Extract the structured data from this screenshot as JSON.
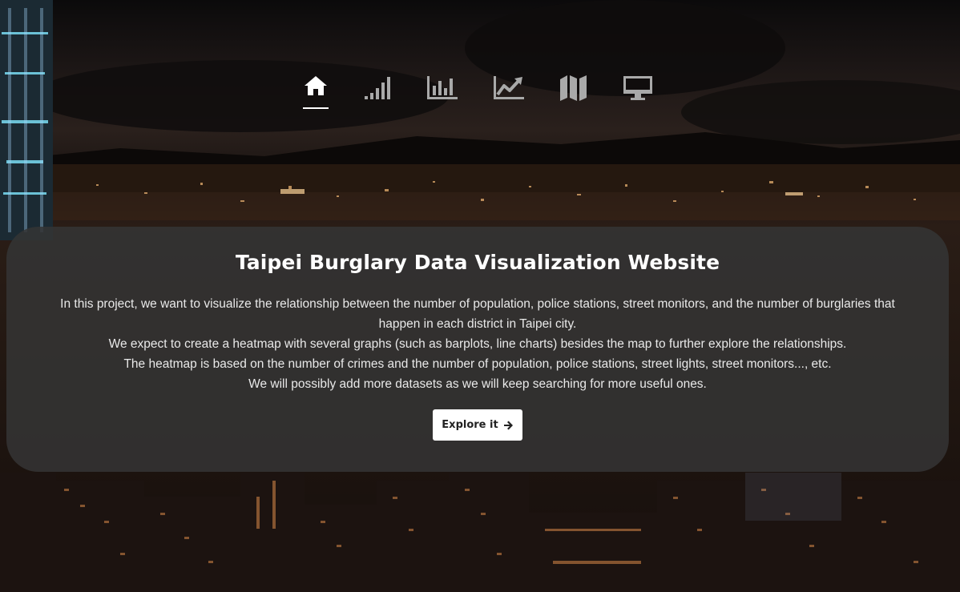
{
  "colors": {
    "nav_active": "#ffffff",
    "nav_inactive": "#a9a9a9",
    "card_background": "#343434",
    "button_background": "#ffffff",
    "button_text": "#222222"
  },
  "nav": {
    "items": [
      {
        "icon": "home-icon",
        "active": true
      },
      {
        "icon": "signal-bars-icon",
        "active": false
      },
      {
        "icon": "bar-chart-icon",
        "active": false
      },
      {
        "icon": "line-chart-icon",
        "active": false
      },
      {
        "icon": "map-icon",
        "active": false
      },
      {
        "icon": "desktop-icon",
        "active": false
      }
    ]
  },
  "hero": {
    "title": "Taipei Burglary Data Visualization Website",
    "paragraphs": [
      "In this project, we want to visualize the relationship between the number of population, police stations, street monitors, and the number of burglaries that happen in each district in Taipei city.",
      "We expect to create a heatmap with several graphs (such as barplots, line charts) besides the map to further explore the relationships.",
      "The heatmap is based on the number of crimes and the number of population, police stations, street lights, street monitors..., etc.",
      "We will possibly add more datasets as we will keep searching for more useful ones."
    ],
    "button_label": "Explore it",
    "button_icon": "arrow-right-icon"
  }
}
